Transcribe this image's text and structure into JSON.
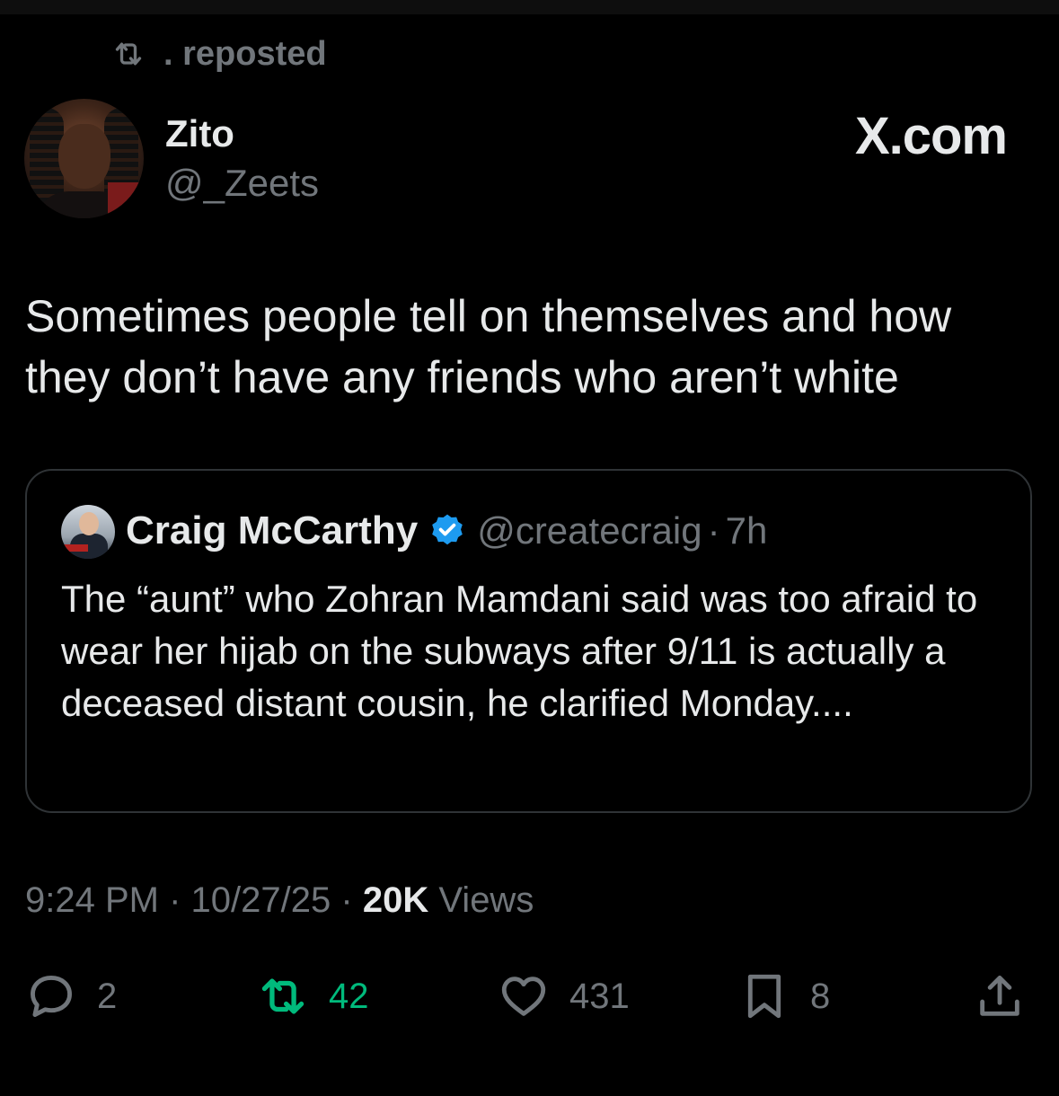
{
  "repost": {
    "label": ". reposted",
    "icon": "repost-icon"
  },
  "author": {
    "display_name": "Zito",
    "handle": "@_Zeets"
  },
  "brand": {
    "label": "X.com"
  },
  "tweet": {
    "text": "Sometimes people tell on themselves and how they don’t have any friends who aren’t white"
  },
  "quote": {
    "display_name": "Craig McCarthy",
    "verified": true,
    "handle": "@createcraig",
    "separator": "·",
    "time": "7h",
    "text": "The “aunt” who Zohran Mamdani said was too afraid to wear her hijab on the subways after 9/11 is actually a deceased distant cousin, he clarified Monday...."
  },
  "meta": {
    "time": "9:24 PM",
    "date": "10/27/25",
    "views_count": "20K",
    "views_label": "Views",
    "separator": "·"
  },
  "actions": {
    "reply_count": "2",
    "repost_count": "42",
    "like_count": "431",
    "bookmark_count": "8"
  },
  "colors": {
    "background": "#000000",
    "text_primary": "#e7e9ea",
    "text_secondary": "#71767b",
    "repost_active": "#00ba7c",
    "verified_blue": "#1d9bf0",
    "border": "#2f3336"
  }
}
